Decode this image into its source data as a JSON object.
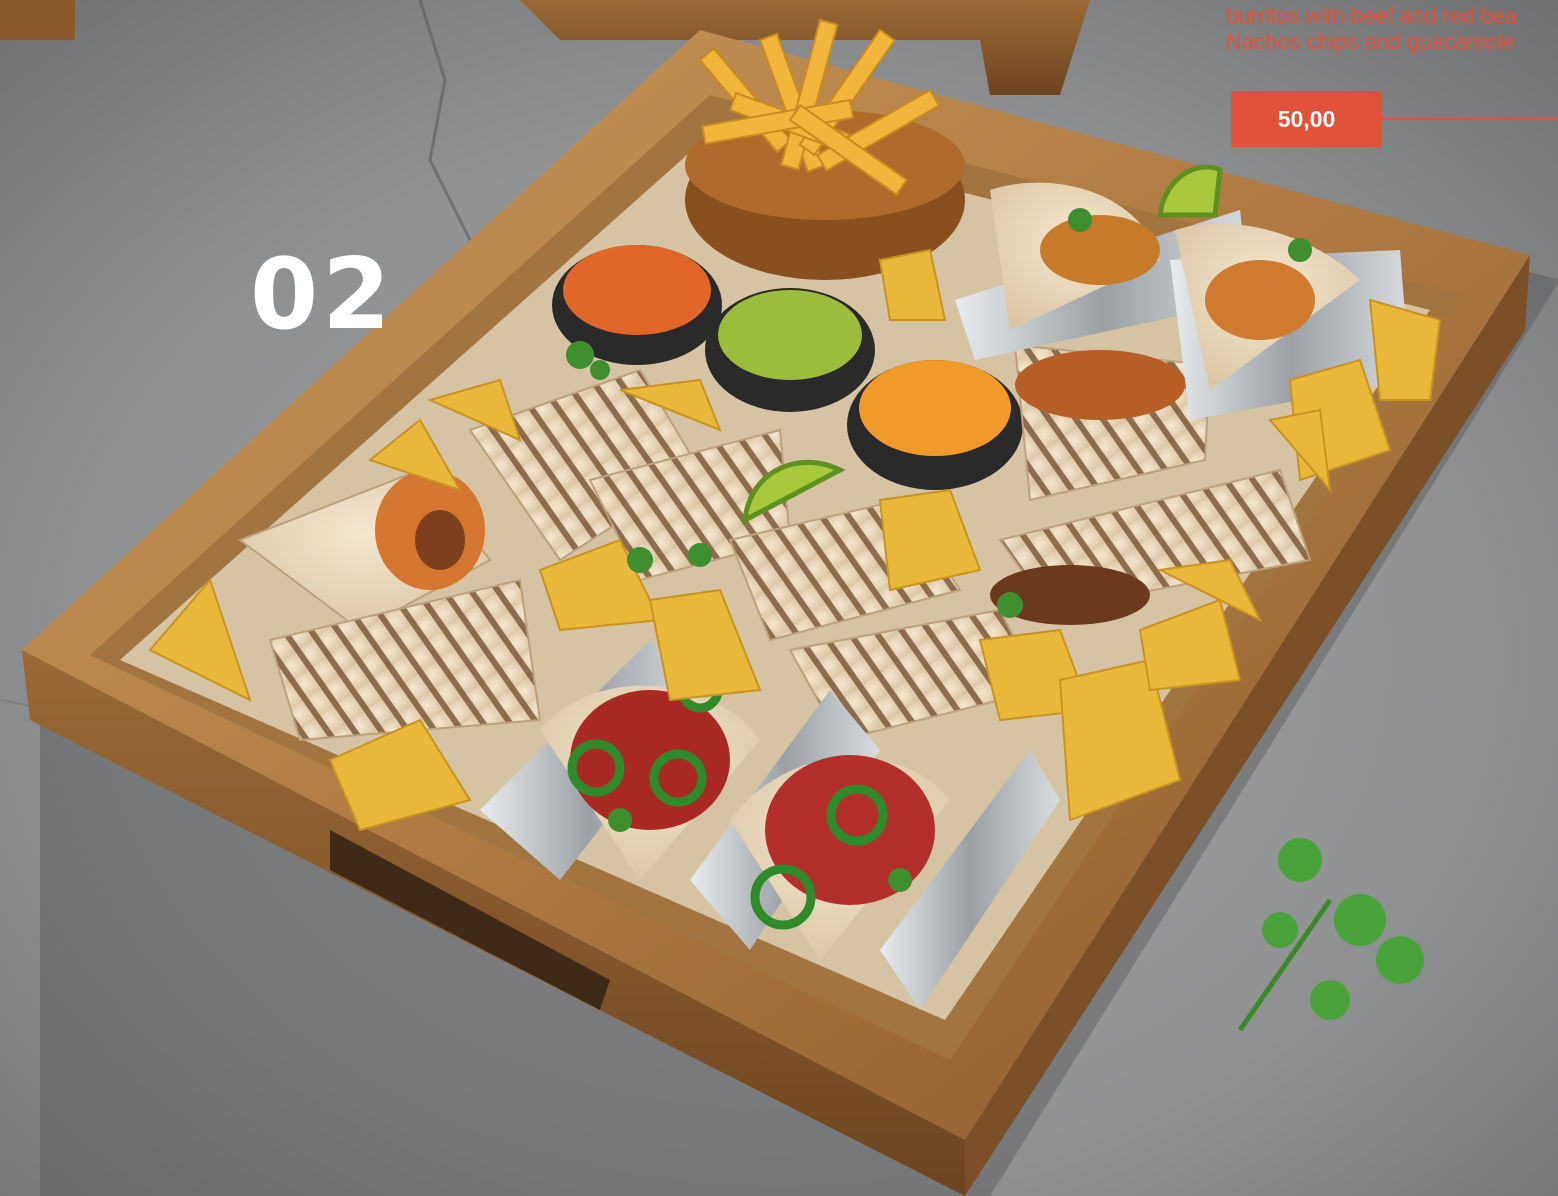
{
  "menu_item": {
    "number": "02",
    "description_lines": [
      "burritos with beef and red bea",
      "Nachos chips and guacamole"
    ],
    "price": "50,00"
  },
  "colors": {
    "accent": "#e2523a",
    "background": "#8d8f90",
    "tray_wood": "#b9854a",
    "number_text": "#ffffff"
  },
  "photo_subject": "wooden tray with burritos, tacos, fries, nachos and dipping sauces"
}
